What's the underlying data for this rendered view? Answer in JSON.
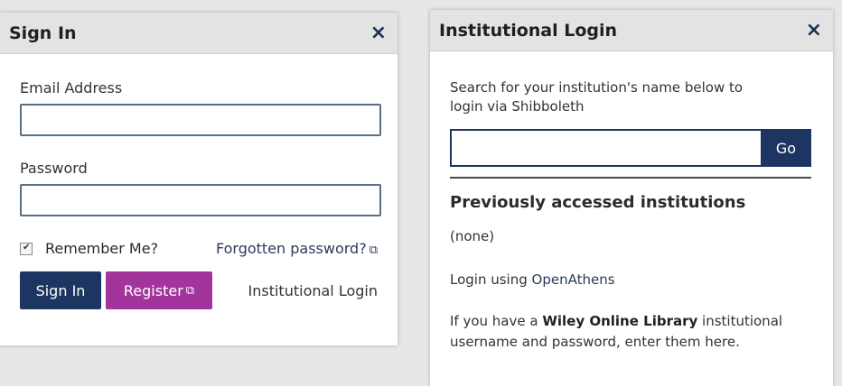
{
  "signin": {
    "title": "Sign In",
    "close_icon": "×",
    "email_label": "Email Address",
    "password_label": "Password",
    "remember_label": "Remember Me?",
    "forgot_label": "Forgotten password?",
    "sign_in_button": "Sign In",
    "register_button": "Register",
    "institutional_login_link": "Institutional Login",
    "colors": {
      "sign_in_button": "#1d3661",
      "register_button": "#a3349c"
    }
  },
  "institutional": {
    "title": "Institutional Login",
    "close_icon": "×",
    "description": "Search for your institution's name below to login via Shibboleth",
    "go_button": "Go",
    "previous_title": "Previously accessed institutions",
    "previous_none": "(none)",
    "openathens_prefix": "Login using ",
    "openathens_link": "OpenAthens",
    "wiley_prefix": "If you have a ",
    "wiley_bold": "Wiley Online Library",
    "wiley_suffix": " institutional username and password, enter them here."
  }
}
